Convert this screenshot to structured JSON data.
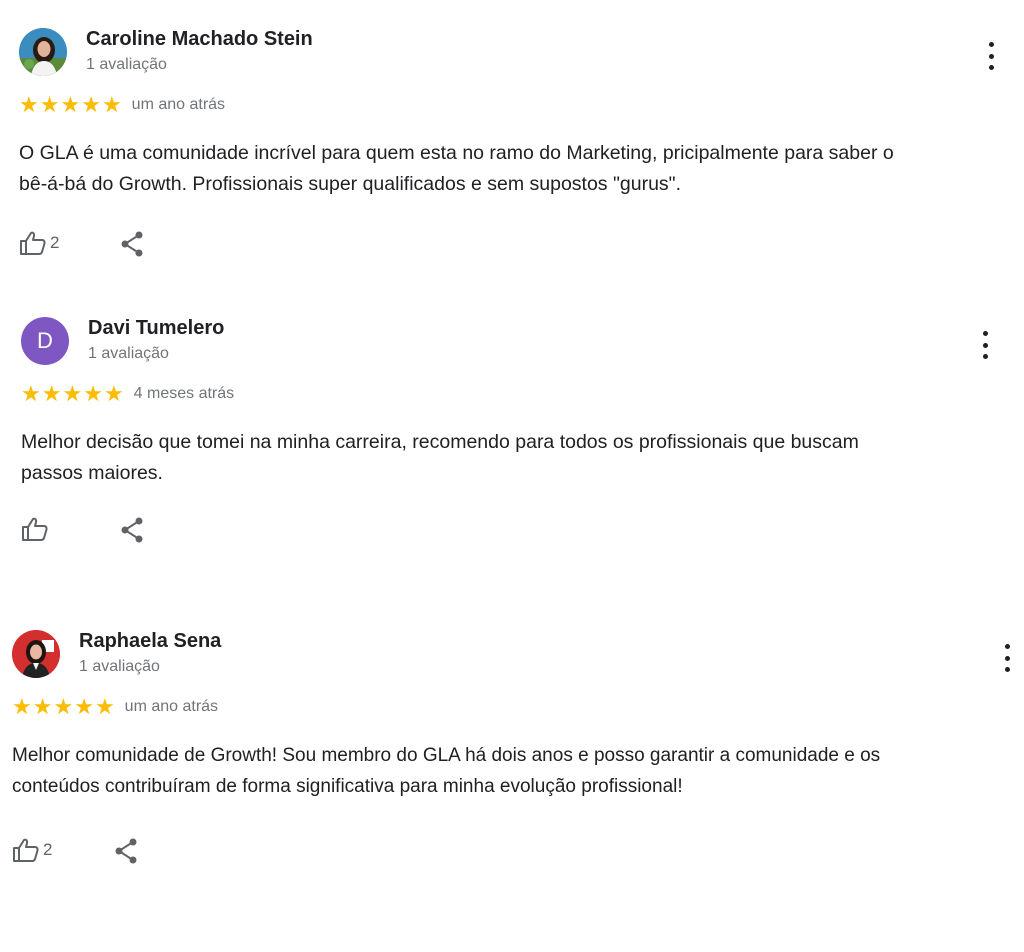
{
  "reviews": [
    {
      "author": "Caroline Machado Stein",
      "review_count": "1 avaliação",
      "rating": 5,
      "time": "um ano atrás",
      "text_lines": [
        "O GLA é uma comunidade incrível para quem esta no ramo do Marketing, pricipalmente para saber o",
        "bê-á-bá do Growth. Profissionais super qualificados e sem supostos \"gurus\"."
      ],
      "likes": "2",
      "avatar_icon": "profile-photo"
    },
    {
      "author": "Davi Tumelero",
      "avatar_letter": "D",
      "avatar_color": "#7e57c2",
      "review_count": "1 avaliação",
      "rating": 5,
      "time": "4 meses atrás",
      "text_lines": [
        "Melhor decisão que tomei na minha carreira, recomendo para todos os profissionais que buscam",
        "passos maiores."
      ],
      "likes": ""
    },
    {
      "author": "Raphaela Sena",
      "review_count": "1 avaliação",
      "rating": 5,
      "time": "um ano atrás",
      "text_lines": [
        "Melhor comunidade de Growth! Sou membro do GLA há dois anos e posso garantir a comunidade e os",
        "conteúdos contribuíram de forma significativa para minha evolução profissional!"
      ],
      "likes": "2",
      "avatar_icon": "profile-photo"
    }
  ],
  "colors": {
    "star": "#fbbc04",
    "secondary_text": "#70757a",
    "primary_text": "#202124"
  },
  "icons": [
    "thumbs-up-icon",
    "share-icon",
    "more-vert-icon",
    "star-icon"
  ]
}
